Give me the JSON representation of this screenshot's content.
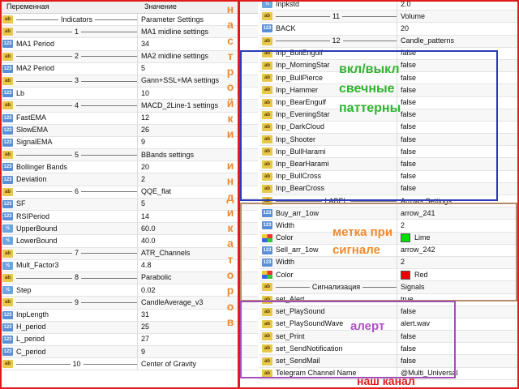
{
  "left": {
    "header": {
      "col1": "Переменная",
      "col2": "Значение"
    },
    "rows": [
      {
        "kind": "sep",
        "icon": "ab",
        "name": "Indicators",
        "value": "Parameter Settings"
      },
      {
        "kind": "sep",
        "icon": "ab",
        "name": "1",
        "value": "MA1 midline settings"
      },
      {
        "kind": "row",
        "icon": "123",
        "name": "MA1 Period",
        "value": "34"
      },
      {
        "kind": "sep",
        "icon": "ab",
        "name": "2",
        "value": "MA2 midline settings"
      },
      {
        "kind": "row",
        "icon": "123",
        "name": "MA2 Period",
        "value": "5"
      },
      {
        "kind": "sep",
        "icon": "ab",
        "name": "3",
        "value": "Gann+SSL+MA settings"
      },
      {
        "kind": "row",
        "icon": "123",
        "name": "Lb",
        "value": "10"
      },
      {
        "kind": "sep",
        "icon": "ab",
        "name": "4",
        "value": "MACD_2Line-1 settings"
      },
      {
        "kind": "row",
        "icon": "123",
        "name": "FastEMA",
        "value": "12"
      },
      {
        "kind": "row",
        "icon": "123",
        "name": "SlowEMA",
        "value": "26"
      },
      {
        "kind": "row",
        "icon": "123",
        "name": "SignalEMA",
        "value": "9"
      },
      {
        "kind": "sep",
        "icon": "ab",
        "name": "5",
        "value": "BBands settings"
      },
      {
        "kind": "row",
        "icon": "123",
        "name": "Bollinger Bands",
        "value": "20"
      },
      {
        "kind": "row",
        "icon": "123",
        "name": "Deviation",
        "value": "2"
      },
      {
        "kind": "sep",
        "icon": "ab",
        "name": "6",
        "value": "QQE_flat"
      },
      {
        "kind": "row",
        "icon": "123",
        "name": "SF",
        "value": "5"
      },
      {
        "kind": "row",
        "icon": "123",
        "name": "RSIPeriod",
        "value": "14"
      },
      {
        "kind": "row",
        "icon": "v2",
        "name": "UpperBound",
        "value": "60.0"
      },
      {
        "kind": "row",
        "icon": "v2",
        "name": "LowerBound",
        "value": "40.0"
      },
      {
        "kind": "sep",
        "icon": "ab",
        "name": "7",
        "value": "ATR_Channels"
      },
      {
        "kind": "row",
        "icon": "v2",
        "name": "Mult_Factor3",
        "value": "4.8"
      },
      {
        "kind": "sep",
        "icon": "ab",
        "name": "8",
        "value": "Parabolic"
      },
      {
        "kind": "row",
        "icon": "v2",
        "name": "Step",
        "value": "0.02"
      },
      {
        "kind": "sep",
        "icon": "ab",
        "name": "9",
        "value": "CandleAverage_v3"
      },
      {
        "kind": "row",
        "icon": "123",
        "name": "InpLength",
        "value": "31"
      },
      {
        "kind": "row",
        "icon": "123",
        "name": "H_period",
        "value": "25"
      },
      {
        "kind": "row",
        "icon": "123",
        "name": "L_period",
        "value": "27"
      },
      {
        "kind": "row",
        "icon": "123",
        "name": "C_period",
        "value": "9"
      },
      {
        "kind": "sep",
        "icon": "ab",
        "name": "10",
        "value": "Center of Gravity"
      }
    ]
  },
  "right": {
    "rows": [
      {
        "kind": "row",
        "icon": "v2",
        "name": "Inpkstd",
        "value": "2.0"
      },
      {
        "kind": "sep",
        "icon": "ab",
        "name": "11",
        "value": "Volume"
      },
      {
        "kind": "row",
        "icon": "123",
        "name": "BACK",
        "value": "20"
      },
      {
        "kind": "sep",
        "icon": "ab",
        "name": "12",
        "value": "Candle_patterns"
      },
      {
        "kind": "row",
        "icon": "ab",
        "name": "Inp_BullEngulf",
        "value": "false"
      },
      {
        "kind": "row",
        "icon": "ab",
        "name": "Inp_MorningStar",
        "value": "false"
      },
      {
        "kind": "row",
        "icon": "ab",
        "name": "Inp_BullPierce",
        "value": "false"
      },
      {
        "kind": "row",
        "icon": "ab",
        "name": "Inp_Hammer",
        "value": "false"
      },
      {
        "kind": "row",
        "icon": "ab",
        "name": "Inp_BearEngulf",
        "value": "false"
      },
      {
        "kind": "row",
        "icon": "ab",
        "name": "Inp_EveningStar",
        "value": "false"
      },
      {
        "kind": "row",
        "icon": "ab",
        "name": "Inp_DarkCloud",
        "value": "false"
      },
      {
        "kind": "row",
        "icon": "ab",
        "name": "Inp_Shooter",
        "value": "false"
      },
      {
        "kind": "row",
        "icon": "ab",
        "name": "Inp_BullHarami",
        "value": "false"
      },
      {
        "kind": "row",
        "icon": "ab",
        "name": "Inp_BearHarami",
        "value": "false"
      },
      {
        "kind": "row",
        "icon": "ab",
        "name": "Inp_BullCross",
        "value": "false"
      },
      {
        "kind": "row",
        "icon": "ab",
        "name": "Inp_BearCross",
        "value": "false"
      },
      {
        "kind": "sep",
        "icon": "ab",
        "name": "LABEL",
        "value": "Arrows Settings"
      },
      {
        "kind": "row",
        "icon": "123",
        "name": "Buy_arr_1ow",
        "value": "arrow_241"
      },
      {
        "kind": "row",
        "icon": "123",
        "name": "Width",
        "value": "2"
      },
      {
        "kind": "row",
        "icon": "clr",
        "name": "Color",
        "value": "Lime",
        "swatch": "#00dd00"
      },
      {
        "kind": "row",
        "icon": "123",
        "name": "Sell_arr_1ow",
        "value": "arrow_242"
      },
      {
        "kind": "row",
        "icon": "123",
        "name": "Width",
        "value": "2"
      },
      {
        "kind": "row",
        "icon": "clr",
        "name": "Color",
        "value": "Red",
        "swatch": "#ee0000"
      },
      {
        "kind": "sep",
        "icon": "ab",
        "name": "Сигнализация",
        "value": "Signals"
      },
      {
        "kind": "row",
        "icon": "ab",
        "name": "set_Alert",
        "value": "true"
      },
      {
        "kind": "row",
        "icon": "ab",
        "name": "set_PlaySound",
        "value": "false"
      },
      {
        "kind": "row",
        "icon": "ab",
        "name": "set_PlaySoundWave",
        "value": "alert.wav"
      },
      {
        "kind": "row",
        "icon": "ab",
        "name": "set_Print",
        "value": "false"
      },
      {
        "kind": "row",
        "icon": "ab",
        "name": "set_SendNotification",
        "value": "false"
      },
      {
        "kind": "row",
        "icon": "ab",
        "name": "set_SendMail",
        "value": "false"
      },
      {
        "kind": "row",
        "icon": "ab",
        "name": "Telegram Channel Name",
        "value": "@Multi_Universal"
      }
    ]
  },
  "annotations": {
    "vertical_letters": [
      "н",
      "а",
      "с",
      "т",
      "р",
      "о",
      "й",
      "к",
      "и",
      "",
      "и",
      "н",
      "д",
      "и",
      "к",
      "а",
      "т",
      "о",
      "р",
      "о",
      "в"
    ],
    "candle_note": [
      "вкл/выкл",
      "свечные",
      "паттерны"
    ],
    "label_note": [
      "метка при",
      "сигнале"
    ],
    "alert_note": "алерт",
    "channel_note": "наш канал"
  },
  "colors": {
    "orange": "#f08a2e",
    "green": "#2fb52f",
    "purple": "#b050c8",
    "blue_box": "#2b3bb5",
    "brown_box": "#b58a6a",
    "purple_box": "#a050b8",
    "red_border": "#e01b1b",
    "channel_red": "#e01b1b"
  }
}
